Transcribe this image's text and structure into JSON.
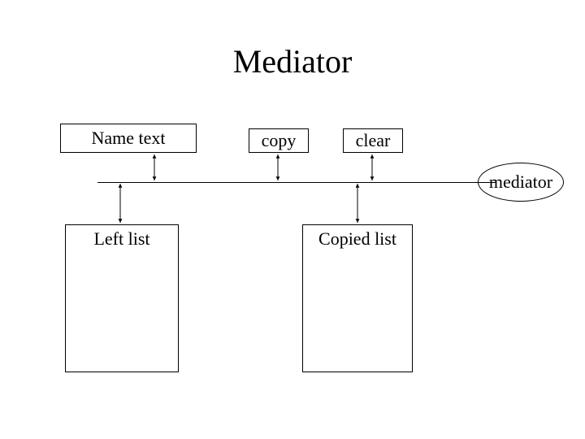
{
  "title": "Mediator",
  "boxes": {
    "name_text": "Name text",
    "copy": "copy",
    "clear": "clear",
    "left_list": "Left list",
    "copied_list": "Copied list"
  },
  "mediator_label": "mediator"
}
